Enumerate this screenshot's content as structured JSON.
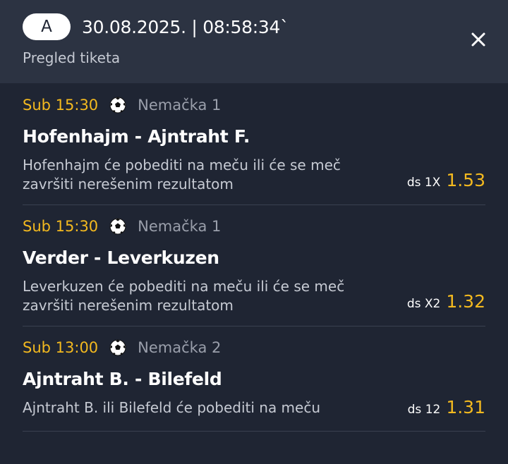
{
  "header": {
    "badge": "A",
    "datetime": "30.08.2025. | 08:58:34`",
    "subtitle": "Pregled tiketa"
  },
  "icons": {
    "close": "close-icon",
    "sport": "soccer-ball-icon"
  },
  "colors": {
    "accent": "#f3b91f",
    "background": "#1f2533",
    "header_background": "#2c3342"
  },
  "tickets": [
    {
      "time": "Sub 15:30",
      "league": "Nemačka 1",
      "match": "Hofenhajm - Ajntraht F.",
      "description": "Hofenhajm će pobediti na meču ili će se meč završiti nerešenim rezultatom",
      "market": "ds 1X",
      "odds": "1.53"
    },
    {
      "time": "Sub 15:30",
      "league": "Nemačka 1",
      "match": "Verder - Leverkuzen",
      "description": "Leverkuzen će pobediti na meču ili će se meč završiti nerešenim rezultatom",
      "market": "ds X2",
      "odds": "1.32"
    },
    {
      "time": "Sub 13:00",
      "league": "Nemačka 2",
      "match": "Ajntraht B. - Bilefeld",
      "description": "Ajntraht B. ili Bilefeld će pobediti na meču",
      "market": "ds 12",
      "odds": "1.31"
    }
  ]
}
